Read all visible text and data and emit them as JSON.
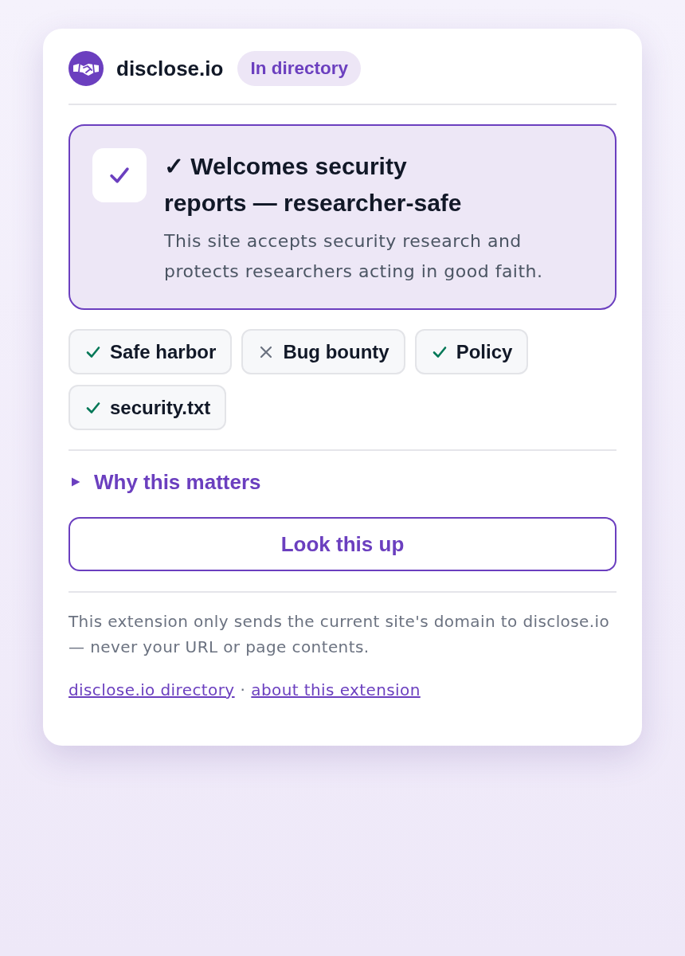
{
  "header": {
    "site": "disclose.io",
    "badge": "In directory"
  },
  "verdict": {
    "title": "✓ Welcomes security reports — researcher-safe",
    "description": "This site accepts security research and protects researchers acting in good faith."
  },
  "checks": [
    {
      "label": "Safe harbor",
      "present": true
    },
    {
      "label": "Bug bounty",
      "present": false
    },
    {
      "label": "Policy",
      "present": true
    },
    {
      "label": "security.txt",
      "present": true
    }
  ],
  "disclosure": {
    "label": "Why this matters",
    "expanded": false
  },
  "action": {
    "label": "Look this up"
  },
  "footer": {
    "note": "This extension only sends the current site's domain to disclose.io — never your URL or page contents.",
    "links": [
      {
        "label": "disclose.io directory"
      },
      {
        "label": "about this extension"
      }
    ],
    "separator": "·"
  }
}
